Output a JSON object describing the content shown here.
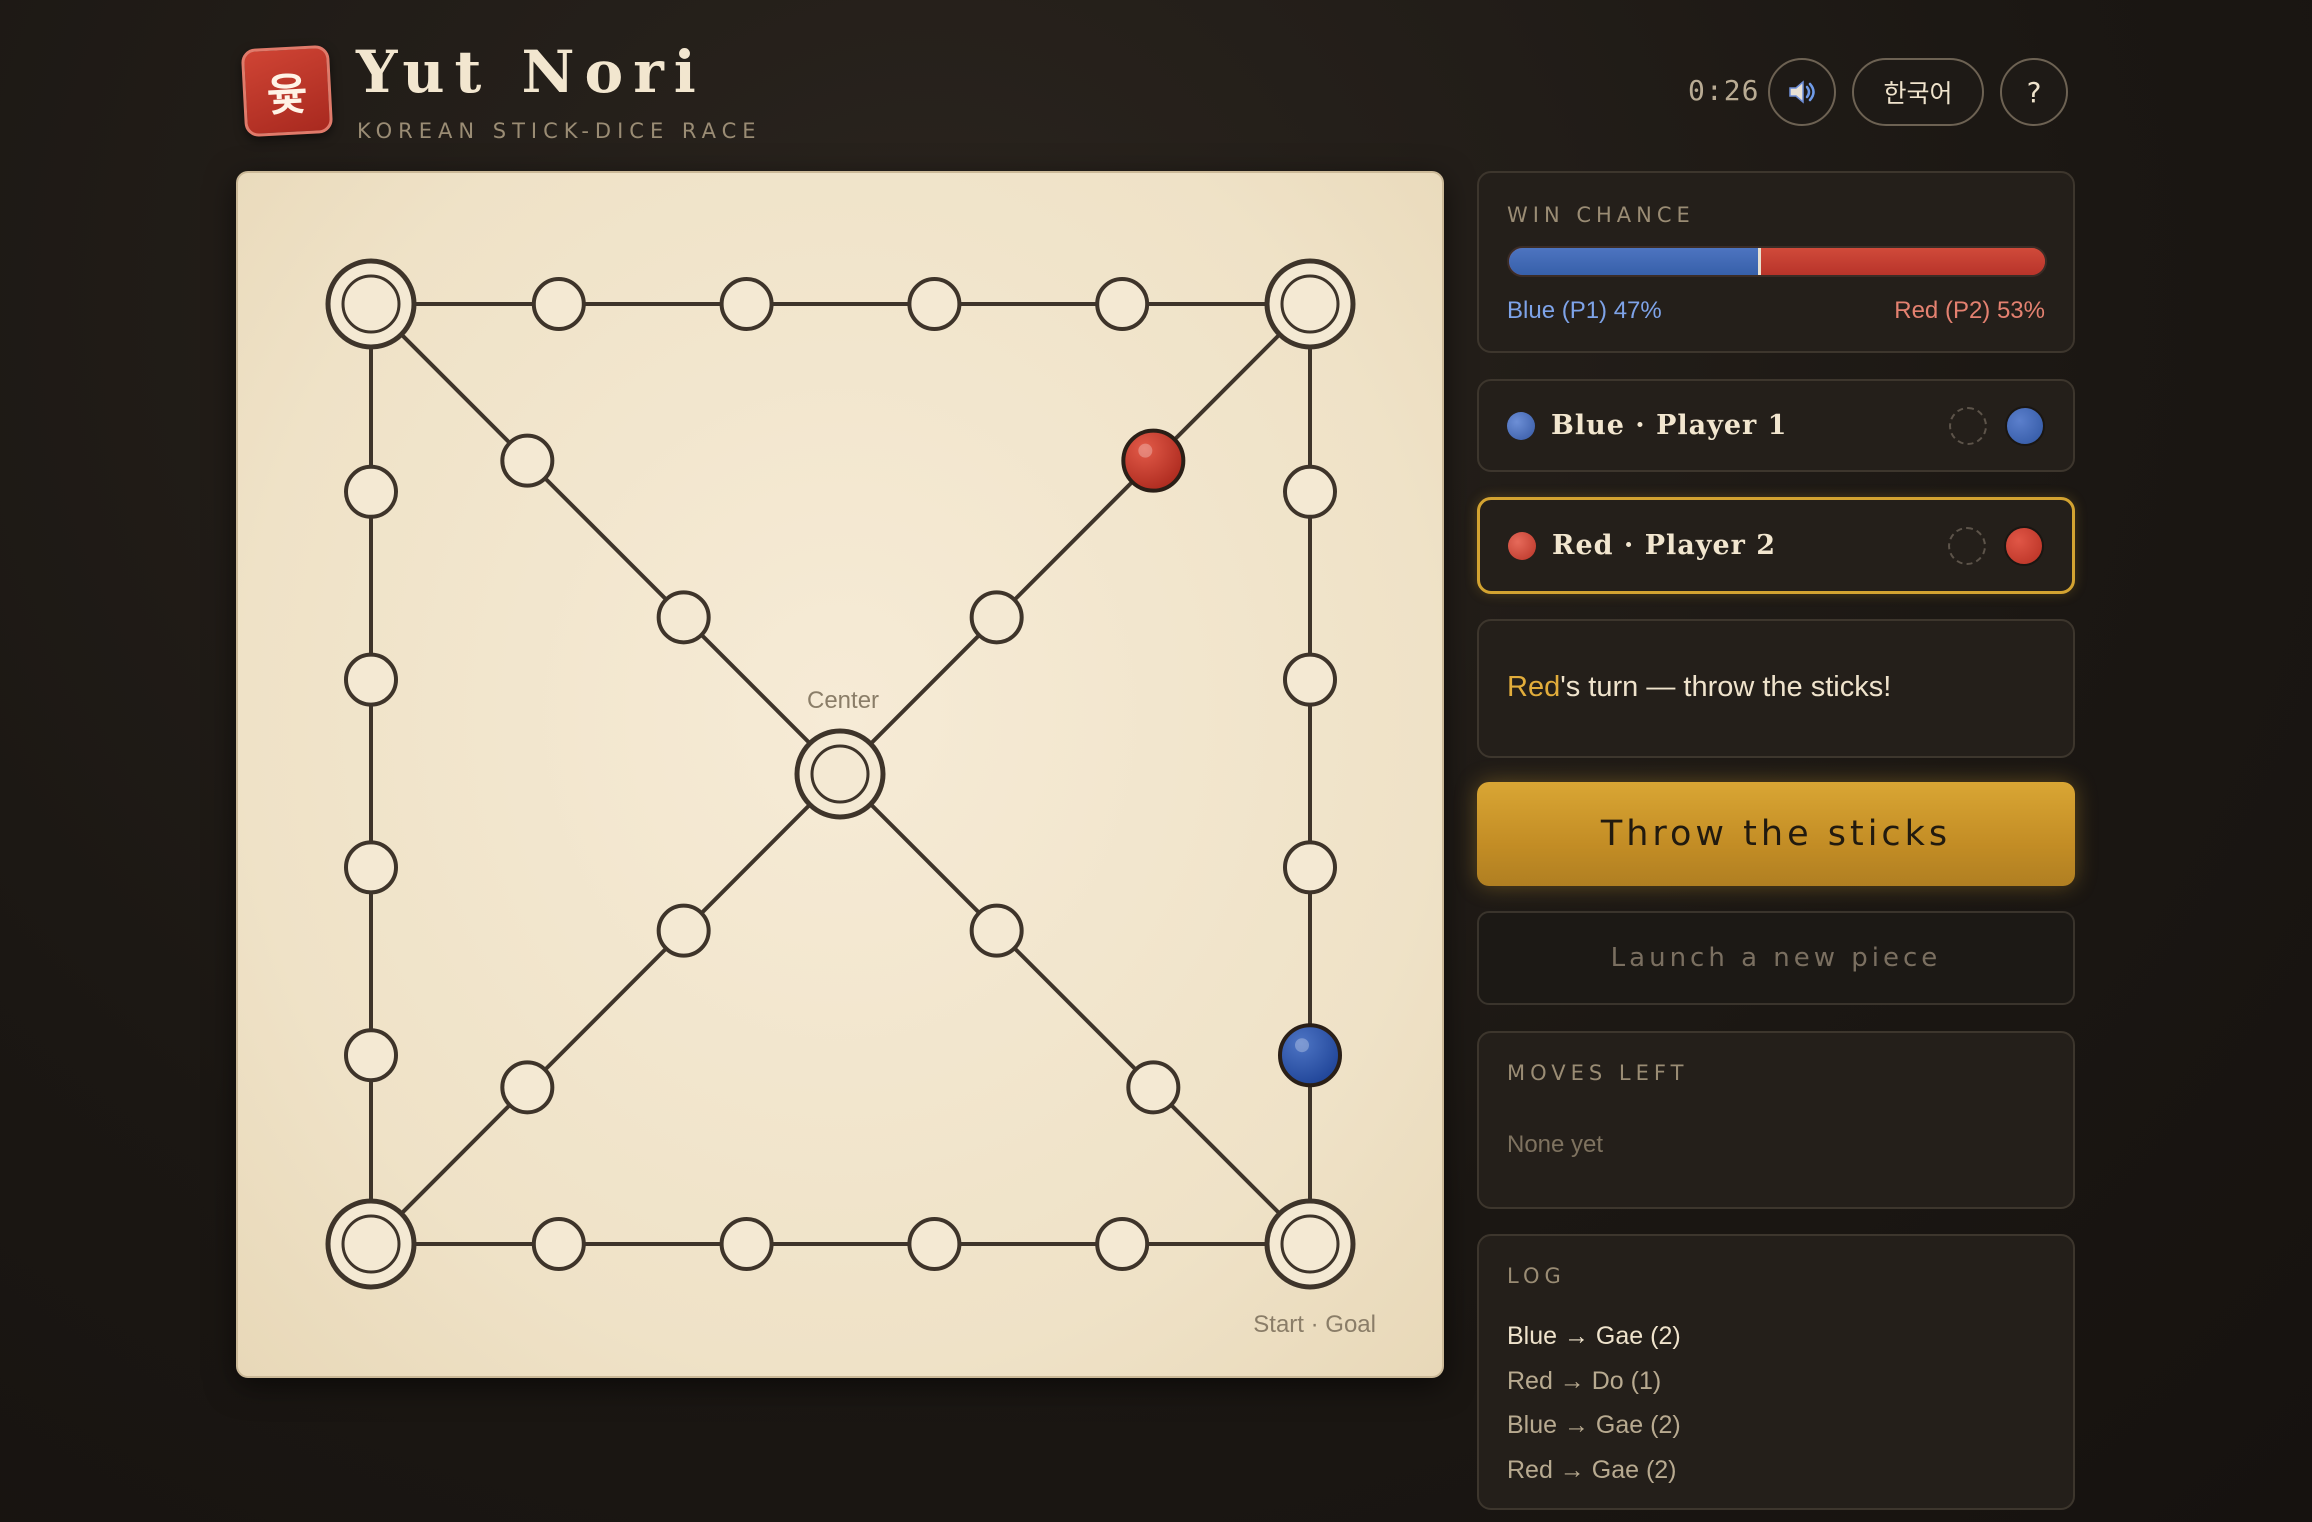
{
  "header": {
    "logo_glyph": "윷",
    "title": "Yut Nori",
    "subtitle": "KOREAN STICK-DICE RACE",
    "timer": "0:26",
    "sound_icon": "speaker-icon",
    "language_label": "한국어",
    "help_label": "?"
  },
  "board": {
    "center_label": "Center",
    "start_label": "Start · Goal",
    "pieces": [
      {
        "player": "red",
        "station": "diag-ne-1"
      },
      {
        "player": "blue",
        "station": "right-1"
      }
    ]
  },
  "win_chance": {
    "label": "WIN CHANCE",
    "blue_label": "Blue (P1) 47%",
    "red_label": "Red (P2) 53%",
    "blue_percent": 47,
    "red_percent": 53
  },
  "players": [
    {
      "name": "Blue · Player 1",
      "color": "#3d64b0",
      "active": false
    },
    {
      "name": "Red · Player 2",
      "color": "#c9392a",
      "active": true
    }
  ],
  "status": {
    "highlight": "Red",
    "rest": "'s turn — throw the sticks!"
  },
  "actions": {
    "throw_label": "Throw the sticks",
    "launch_label": "Launch a new piece"
  },
  "moves": {
    "label": "MOVES LEFT",
    "empty_text": "None yet"
  },
  "log": {
    "label": "LOG",
    "entries": [
      "Blue → Gae (2)",
      "Red → Do (1)",
      "Blue → Gae (2)",
      "Red → Gae (2)"
    ]
  },
  "colors": {
    "accent": "#d3a331",
    "blue": "#3d64b0",
    "red": "#c9392a",
    "board": "#f1e5cc",
    "ink": "#3e342a"
  }
}
